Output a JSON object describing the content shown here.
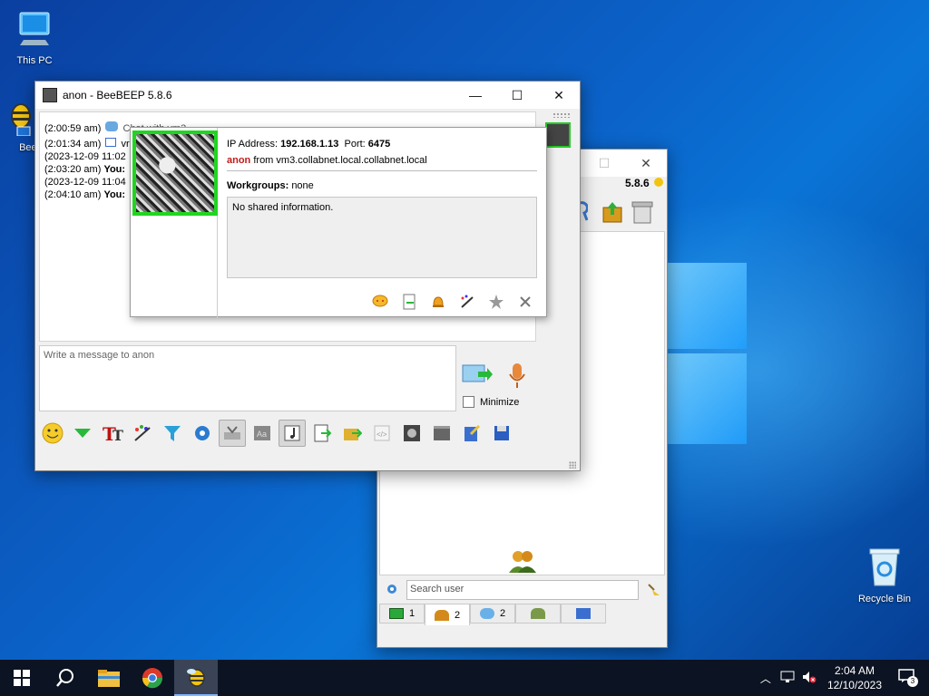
{
  "desktop": {
    "icons": [
      {
        "label": "This PC"
      },
      {
        "label": "BeeB"
      },
      {
        "label": "Recycle Bin"
      }
    ]
  },
  "chat_window": {
    "title": "anon - BeeBEEP 5.8.6",
    "messages": [
      {
        "time": "(2:00:59 am)",
        "text": "Chat with vm3"
      },
      {
        "time": "(2:01:34 am)",
        "text": "vr"
      },
      {
        "time": "(2023-12-09 11:02",
        "text": ""
      },
      {
        "time": "(2:03:20 am)",
        "sender": "You:"
      },
      {
        "time": "(2023-12-09 11:04",
        "text": ""
      },
      {
        "time": "(2:04:10 am)",
        "sender": "You:"
      }
    ],
    "compose_placeholder": "Write a message to anon",
    "minimize_label": "Minimize"
  },
  "user_popup": {
    "ip_label": "IP Address:",
    "ip_value": "192.168.1.13",
    "port_label": "Port:",
    "port_value": "6475",
    "nickname": "anon",
    "host_text": "from vm3.collabnet.local.collabnet.local",
    "workgroups_label": "Workgroups:",
    "workgroups_value": "none",
    "shared_info": "No shared information."
  },
  "main_window": {
    "version": "5.8.6",
    "search_placeholder": "Search user",
    "tabs": [
      {
        "count": "1"
      },
      {
        "count": "2"
      },
      {
        "count": "2"
      },
      {
        "count": ""
      },
      {
        "count": ""
      }
    ]
  },
  "taskbar": {
    "time": "2:04 AM",
    "date": "12/10/2023",
    "notification_count": "3"
  },
  "colors": {
    "avatar_border": "#25c925",
    "nick_red": "#c21b1b",
    "taskbar_bg": "#0c1322"
  }
}
